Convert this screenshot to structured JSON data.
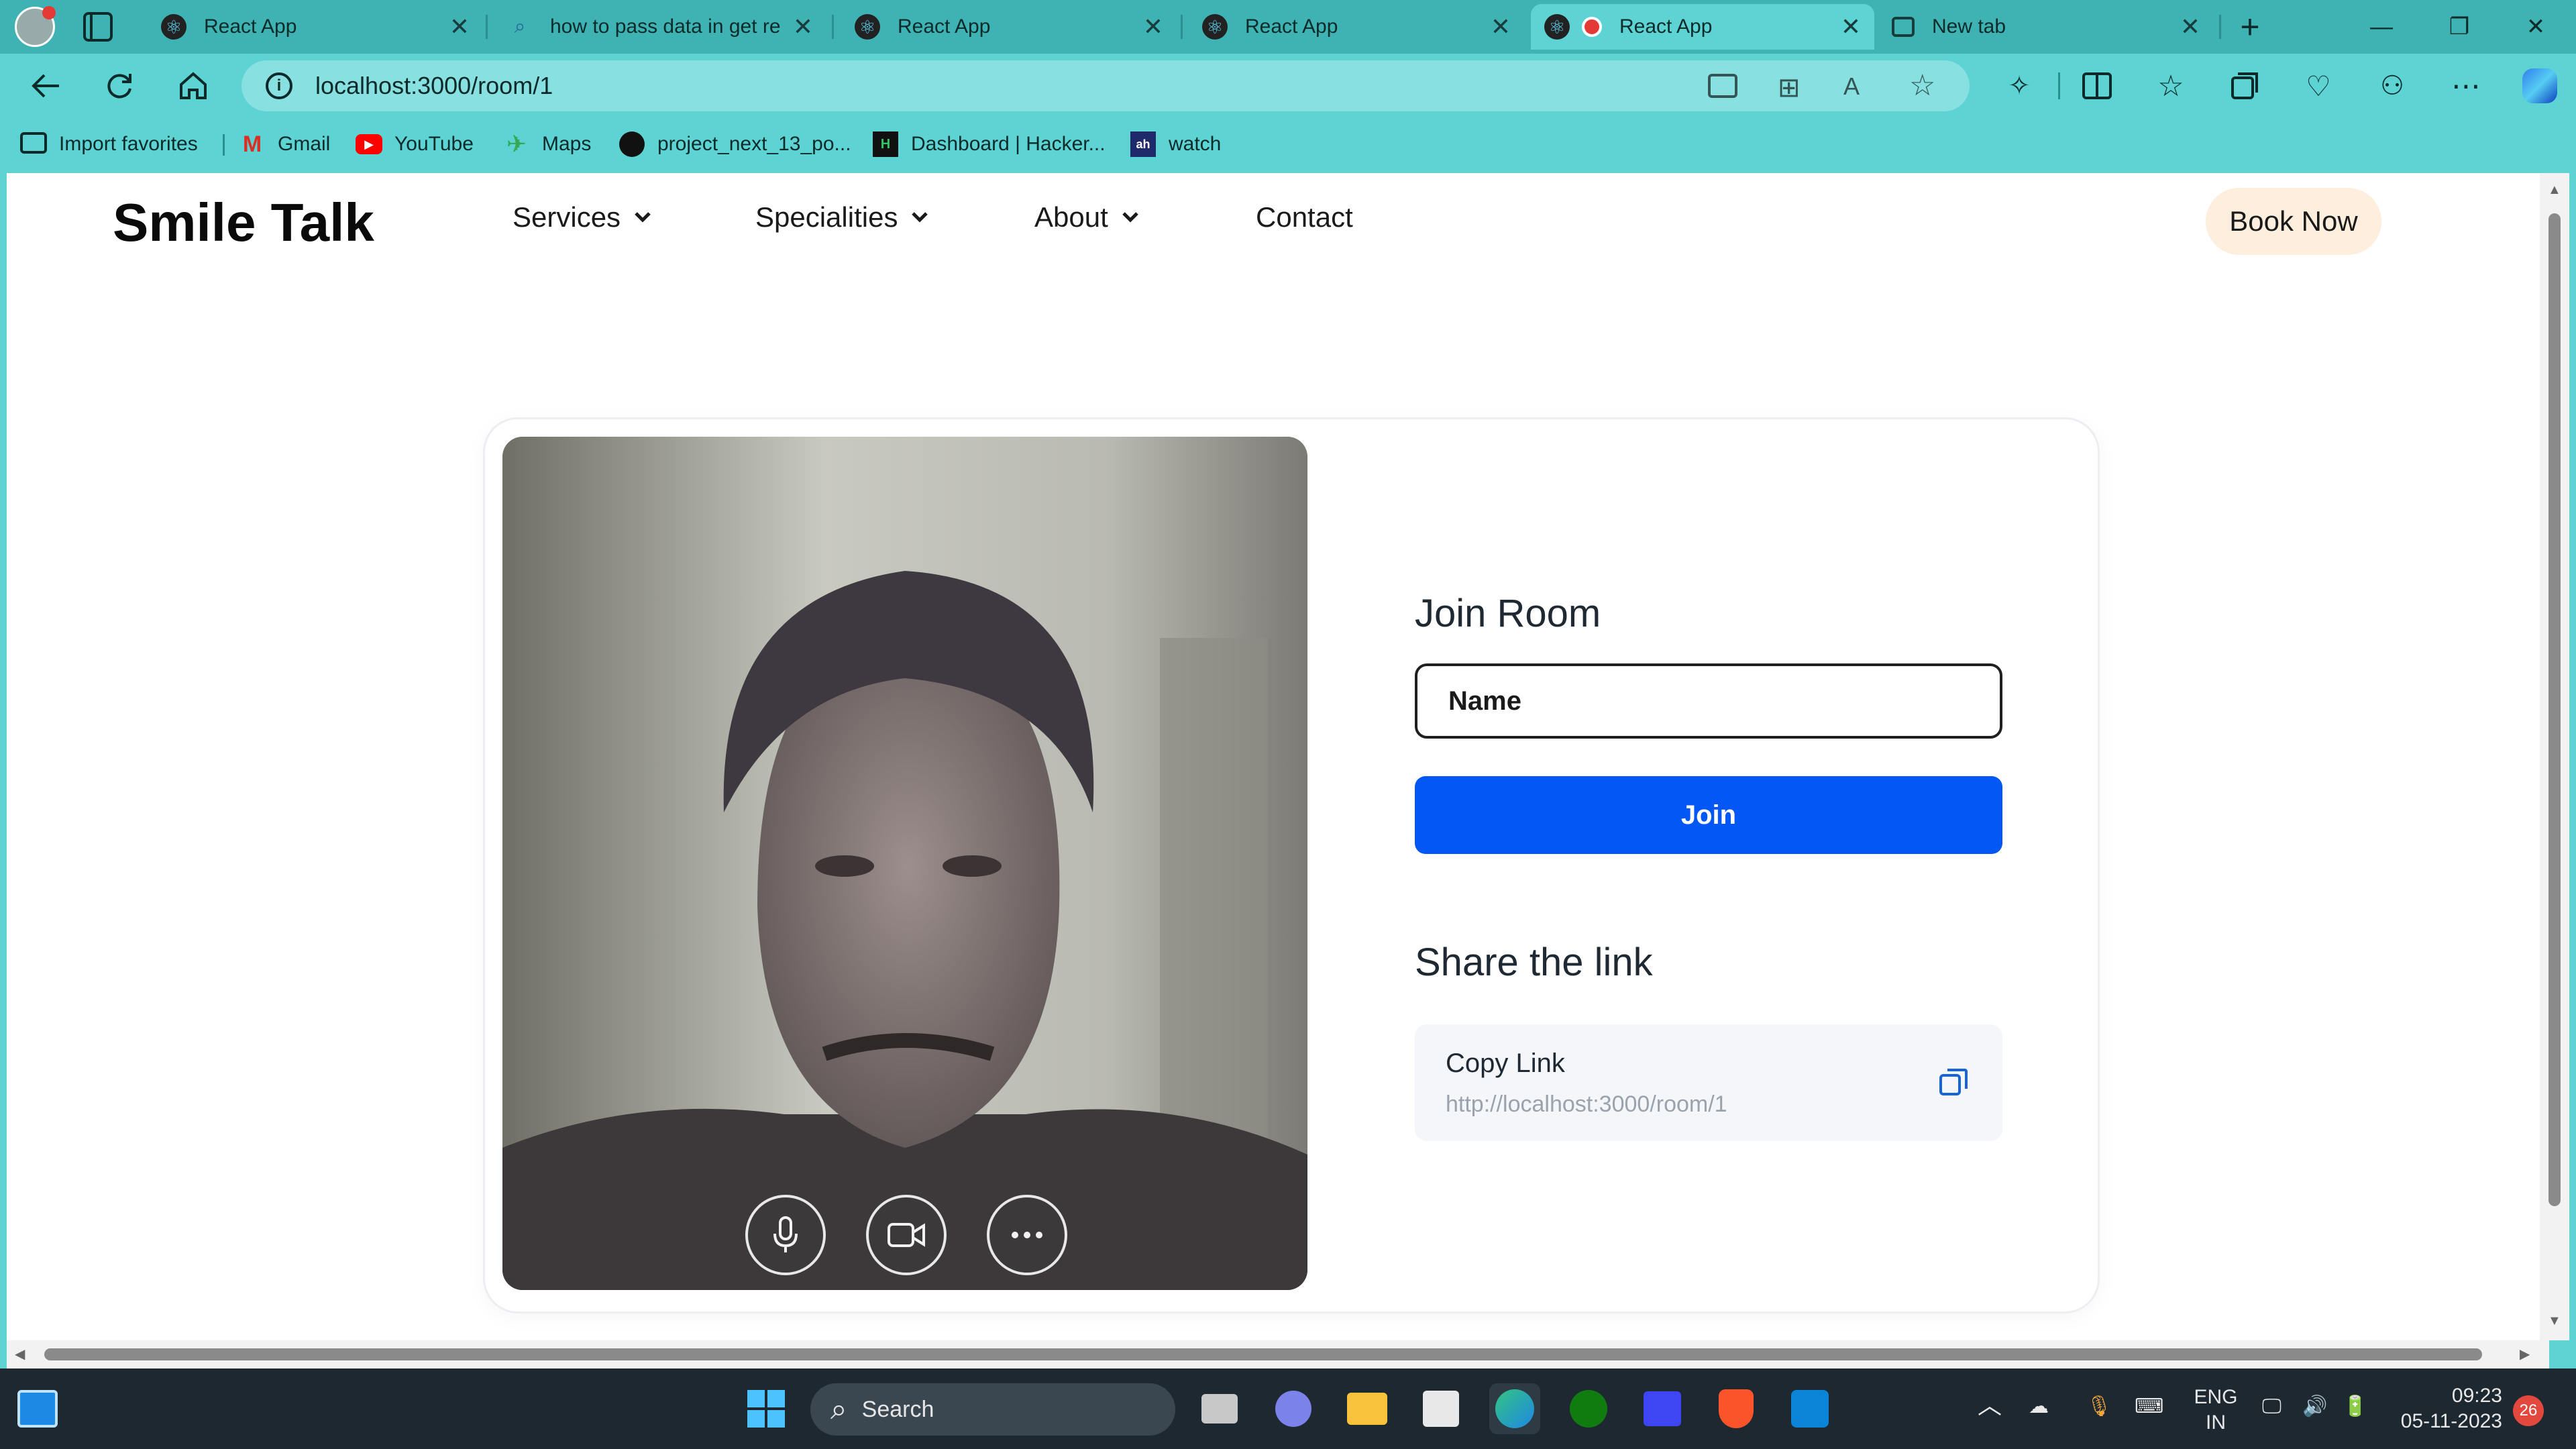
{
  "browser": {
    "tabs": [
      {
        "title": "React App",
        "active": false
      },
      {
        "title": "how to pass data in get re",
        "active": false
      },
      {
        "title": "React App",
        "active": false
      },
      {
        "title": "React App",
        "active": false
      },
      {
        "title": "React App",
        "active": true
      },
      {
        "title": "New tab",
        "active": false
      }
    ],
    "url": "localhost:3000/room/1",
    "bookmarks": [
      {
        "label": "Import favorites",
        "icon": "import-icon"
      },
      {
        "label": "Gmail",
        "icon": "gmail-icon"
      },
      {
        "label": "YouTube",
        "icon": "youtube-icon"
      },
      {
        "label": "Maps",
        "icon": "maps-icon"
      },
      {
        "label": "project_next_13_po...",
        "icon": "github-icon"
      },
      {
        "label": "Dashboard | Hacker...",
        "icon": "hackerrank-icon"
      },
      {
        "label": "watch",
        "icon": "watch-icon"
      }
    ]
  },
  "site": {
    "brand": "Smile Talk",
    "nav": [
      {
        "label": "Services",
        "dropdown": true
      },
      {
        "label": "Specialities",
        "dropdown": true
      },
      {
        "label": "About",
        "dropdown": true
      },
      {
        "label": "Contact",
        "dropdown": false
      }
    ],
    "cta": "Book Now",
    "accent_color": "#0357f5",
    "cta_color": "#fdeedd"
  },
  "room": {
    "join_title": "Join Room",
    "name_placeholder": "Name",
    "join_button": "Join",
    "share_title": "Share the link",
    "copy_label": "Copy Link",
    "copy_url": "http://localhost:3000/room/1",
    "video_controls": [
      "microphone-icon",
      "camera-icon",
      "more-icon"
    ]
  },
  "taskbar": {
    "search_label": "Search",
    "lang_top": "ENG",
    "lang_bottom": "IN",
    "time": "09:23",
    "date": "05-11-2023",
    "notifications": "26"
  }
}
